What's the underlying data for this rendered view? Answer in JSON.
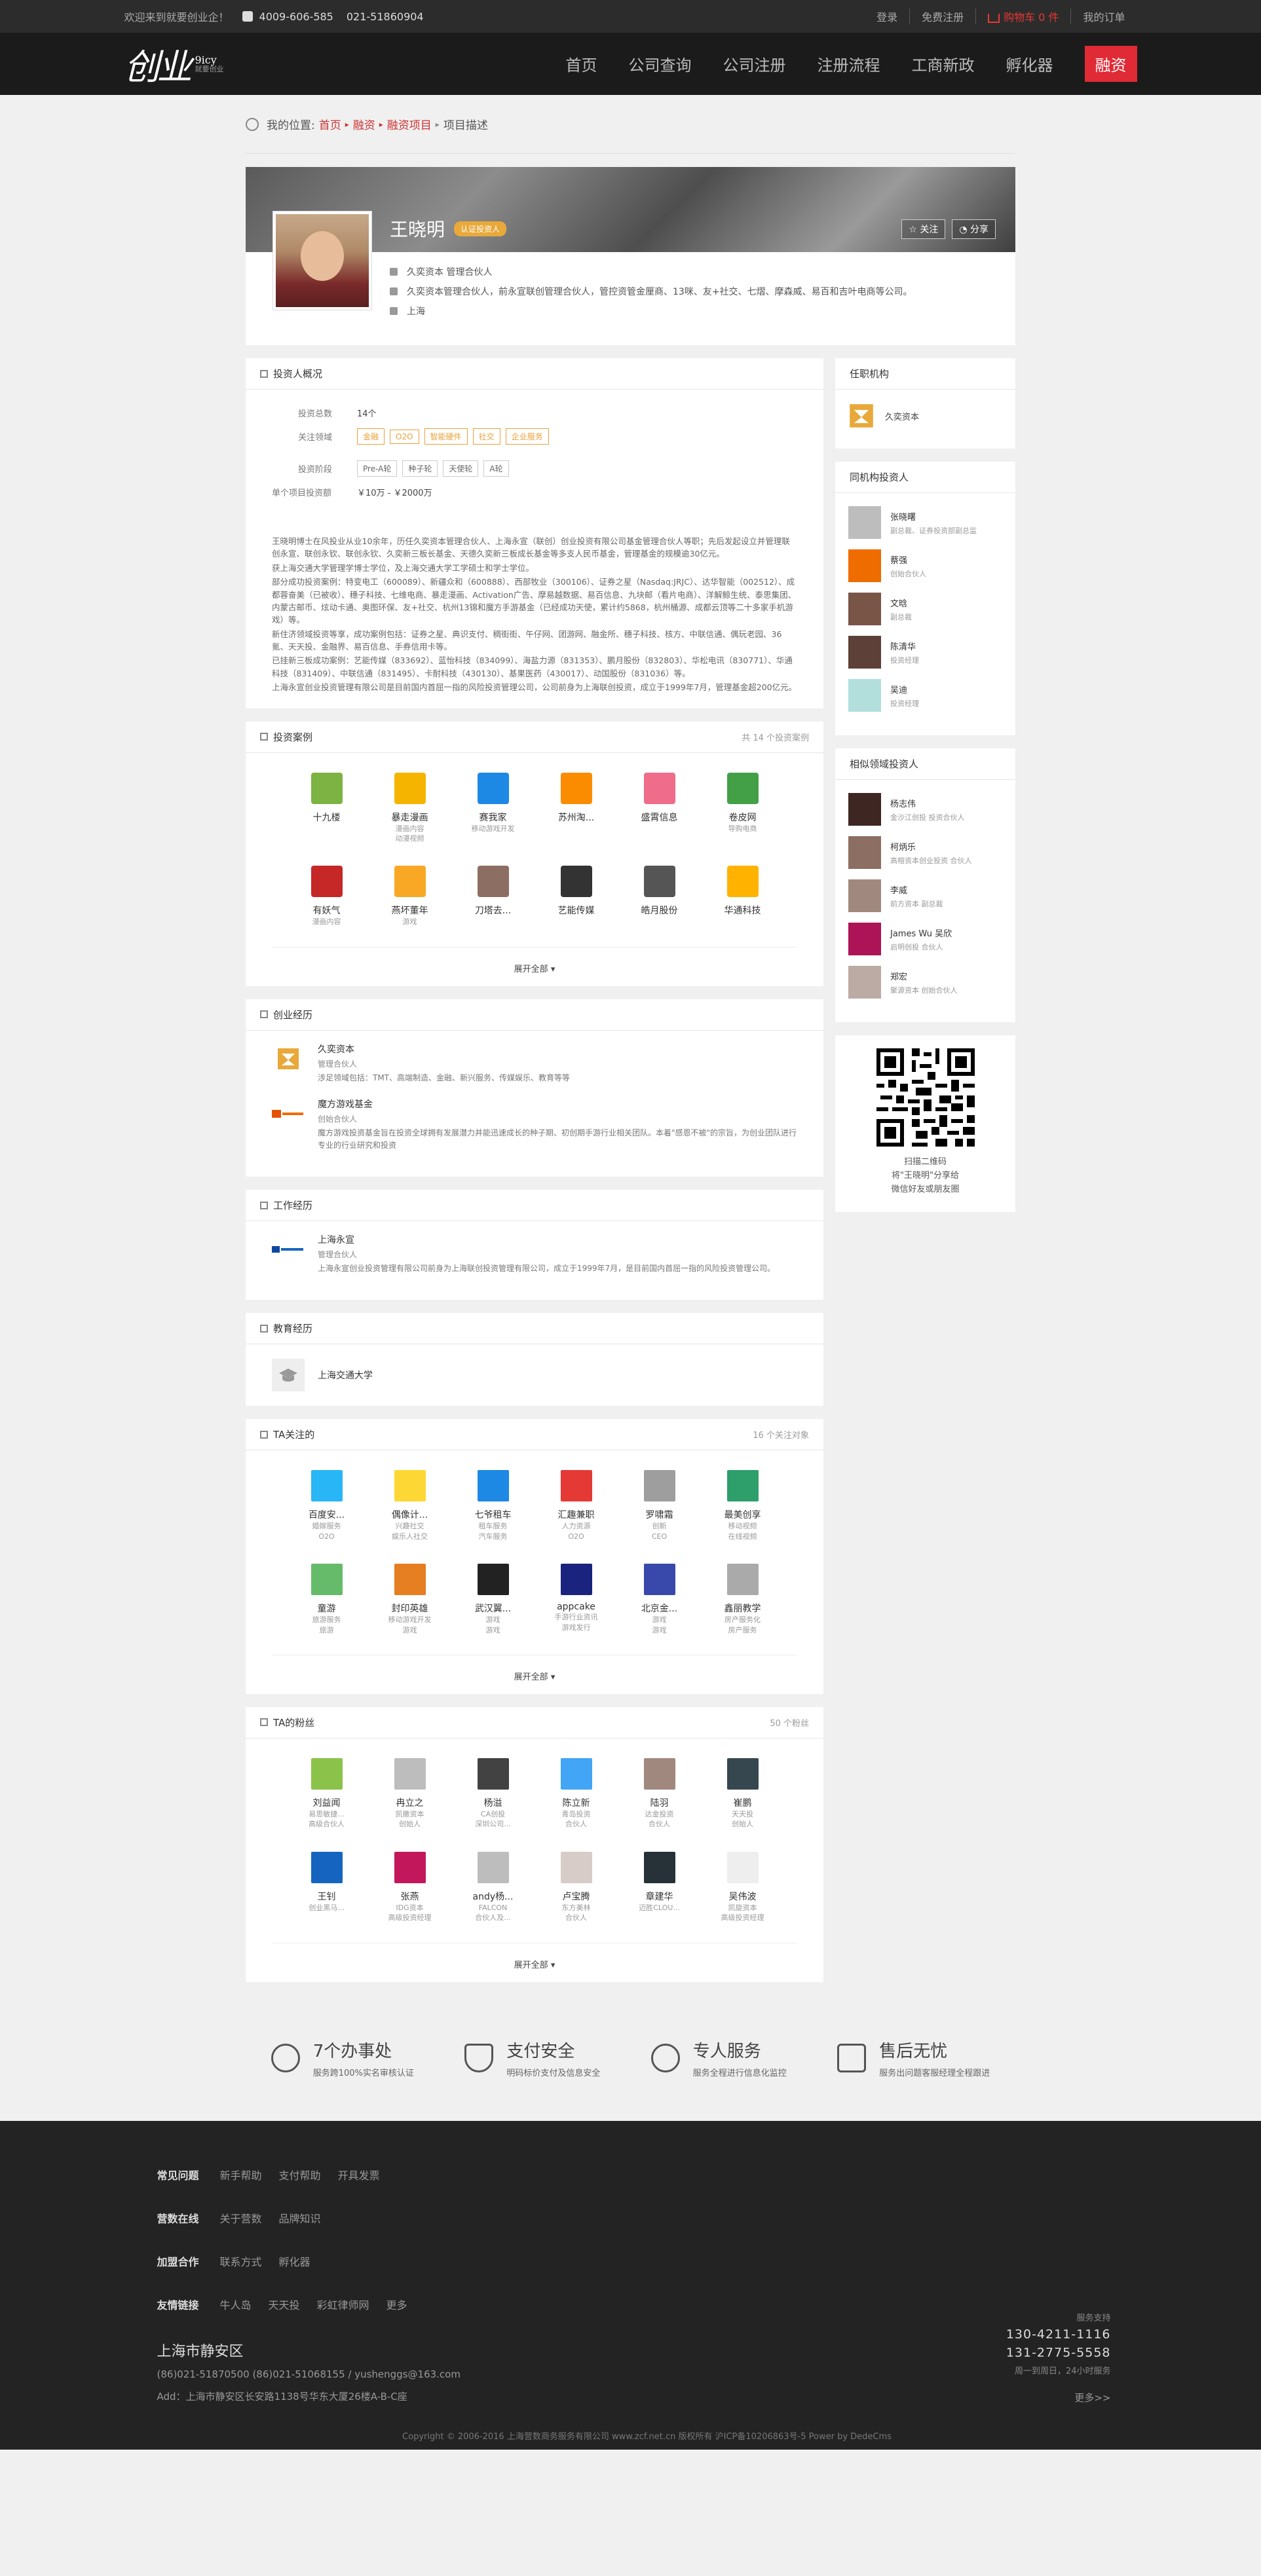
{
  "topbar": {
    "welcome": "欢迎来到就要创业企！",
    "phone1": "4009-606-585",
    "phone2": "021-51860904",
    "login": "登录",
    "register": "免费注册",
    "cart": "购物车 0 件",
    "orders": "我的订单"
  },
  "logo": {
    "text": "创业",
    "en": "9icy",
    "sub": "就要创业"
  },
  "nav": {
    "items": [
      "首页",
      "公司查询",
      "公司注册",
      "注册流程",
      "工商新政",
      "孵化器"
    ],
    "active": "融资"
  },
  "breadcrumb": {
    "label": "我的位置:",
    "items": [
      "首页",
      "融资",
      "融资项目"
    ],
    "current": "项目描述"
  },
  "profile": {
    "name": "王晓明",
    "badge": "认证投资人",
    "follow": "关注",
    "share": "分享",
    "title": "久奕资本 管理合伙人",
    "desc": "久奕资本管理合伙人，前永宣联创管理合伙人，管控资管金厘商、13咪、友+社交、七熠、摩森威、易百和吉叶电商等公司。",
    "location": "上海"
  },
  "overview": {
    "heading": "投资人概况",
    "count_label": "投资总数",
    "count": "14个",
    "fields_label": "关注领域",
    "fields": [
      "金融",
      "O2O",
      "智能硬件",
      "社交",
      "企业服务"
    ],
    "stages_label": "投资阶段",
    "stages": [
      "Pre-A轮",
      "种子轮",
      "天使轮",
      "A轮"
    ],
    "amount_label": "单个项目投资额",
    "amount": "￥10万 - ￥2000万",
    "paragraphs": [
      "王晓明博士在风投业从业10余年，历任久奕资本管理合伙人、上海永宣（联创）创业投资有限公司基金管理合伙人等职；先后发起设立并管理联创永宣、联创永钦、联创永钦、久奕新三板长基金、天德久奕新三板成长基金等多支人民币基金，管理基金的规模逾30亿元。",
      "获上海交通大学管理学博士学位，及上海交通大学工学硕士和学士学位。",
      "部分成功投资案例：特变电工（600089）、新疆众和（600888）、西部牧业（300106）、证券之星（Nasdaq:JRJC）、达华智能（002512）、成都蓉奋美（已被收）、穗子科技、七维电商、暴走漫画、Activation广告、摩易越数据、易百信息、九块邮（看片电商）、洋解鲸生统、泰思集团、内蒙古邮币、炫动卡通、奥图环保、友+社交、杭州13锦和魔方手游基金（已经成功天使，累计约5868，杭州桶源、成都云顶等二十多家手机游戏）等。",
      "新住济领域投资等享，成功案例包括：证券之星、典识支付、稠街街、午仔网、团游网、融金所、穗子科技、核方、中联信通、偶玩老园、36氪、天天投、金融界、易百信息、手券信用卡等。",
      "已挂新三板成功案例：艺能传媒（833692）、蓝怡科技（834099）、海盐力源（831353）、鹏月股份（832803）、华松电讯（830771）、华通科技（831409）、中联信通（831495）、卡耐科技（430130）、基果医药（430017）、动国股份（831036）等。",
      "上海永宣创业投资管理有限公司是目前国内首屈一指的风险投资管理公司，公司前身为上海联创投资，成立于1999年7月，管理基金超200亿元。"
    ]
  },
  "cases": {
    "heading": "投资案例",
    "count": "共 14 个投资案例",
    "more": "展开全部",
    "items": [
      {
        "name": "十九楼",
        "sub": "",
        "color": "#7cb342"
      },
      {
        "name": "暴走漫画",
        "sub": "漫画内容\n动漫视频",
        "color": "#f4b400"
      },
      {
        "name": "赛我家",
        "sub": "移动游戏开发",
        "color": "#1e88e5"
      },
      {
        "name": "苏州淘...",
        "sub": "",
        "color": "#fb8c00"
      },
      {
        "name": "盛霄信息",
        "sub": "",
        "color": "#ef6c8a"
      },
      {
        "name": "卷皮网",
        "sub": "导购电商",
        "color": "#43a047"
      },
      {
        "name": "有妖气",
        "sub": "漫画内容",
        "color": "#c62828"
      },
      {
        "name": "燕坏董年",
        "sub": "游戏",
        "color": "#f9a825"
      },
      {
        "name": "刀塔去...",
        "sub": "",
        "color": "#8d6e63"
      },
      {
        "name": "艺能传媒",
        "sub": "",
        "color": "#333333"
      },
      {
        "name": "皓月股份",
        "sub": "",
        "color": "#555555"
      },
      {
        "name": "华通科技",
        "sub": "",
        "color": "#ffb300"
      }
    ]
  },
  "startup": {
    "heading": "创业经历",
    "items": [
      {
        "name": "久奕资本",
        "role": "管理合伙人",
        "desc": "涉足领域包括：TMT、高端制造、金融、新兴服务、传媒娱乐、教育等等",
        "color": "#e8a93a"
      },
      {
        "name": "魔方游戏基金",
        "role": "创始合伙人",
        "desc": "魔方游戏投资基金旨在投资全球拥有发展潜力并能迅速成长的种子期、初创期手游行业相关团队。本着\"感恩不被\"的宗旨，为创业团队进行专业的行业研究和投资",
        "color": "#e65100"
      }
    ]
  },
  "work": {
    "heading": "工作经历",
    "items": [
      {
        "name": "上海永宣",
        "role": "管理合伙人",
        "desc": "上海永宣创业投资管理有限公司前身为上海联创投资管理有限公司，成立于1999年7月，是目前国内首屈一指的风险投资管理公司。",
        "color": "#0d47a1"
      }
    ]
  },
  "education": {
    "heading": "教育经历",
    "school": "上海交通大学"
  },
  "following": {
    "heading": "TA关注的",
    "count": "16 个关注对象",
    "more": "展开全部",
    "items": [
      {
        "name": "百度安...",
        "sub": "婚嫁服务\nO2O",
        "color": "#29b6f6"
      },
      {
        "name": "偶像计...",
        "sub": "兴趣社交\n娱乐人社交",
        "color": "#fdd835"
      },
      {
        "name": "七爷租车",
        "sub": "租车服务\n汽车服务",
        "color": "#1e88e5"
      },
      {
        "name": "汇趣兼职",
        "sub": "人力资源\nO2O",
        "color": "#e53935"
      },
      {
        "name": "罗啸霜",
        "sub": "创新\nCEO",
        "color": "#9e9e9e"
      },
      {
        "name": "最美创享",
        "sub": "移动视频\n在线视频",
        "color": "#2e9e6a"
      },
      {
        "name": "童游",
        "sub": "旅游服务\n旅游",
        "color": "#66bb6a"
      },
      {
        "name": "封印英雄",
        "sub": "移动游戏开发\n游戏",
        "color": "#e67e22"
      },
      {
        "name": "武汉翼...",
        "sub": "游戏\n游戏",
        "color": "#222222"
      },
      {
        "name": "appcake",
        "sub": "手游行业资讯\n游戏发行",
        "color": "#1a237e"
      },
      {
        "name": "北京金...",
        "sub": "游戏\n游戏",
        "color": "#3949ab"
      },
      {
        "name": "鑫丽教学",
        "sub": "房产服务化\n房产服务",
        "color": "#aaaaaa"
      }
    ]
  },
  "fans": {
    "heading": "TA的粉丝",
    "count": "50 个粉丝",
    "more": "展开全部",
    "items": [
      {
        "name": "刘益闻",
        "sub": "易思敏捷...\n高级合伙人",
        "color": "#8bc34a"
      },
      {
        "name": "冉立之",
        "sub": "凯撒资本\n创始人",
        "color": "#bdbdbd"
      },
      {
        "name": "杨溢",
        "sub": "CA创投\n深圳公司...",
        "color": "#424242"
      },
      {
        "name": "陈立新",
        "sub": "青岛投资\n合伙人",
        "color": "#42a5f5"
      },
      {
        "name": "陆羽",
        "sub": "达金投资\n合伙人",
        "color": "#a1887f"
      },
      {
        "name": "崔鹏",
        "sub": "天天投\n创始人",
        "color": "#37474f"
      },
      {
        "name": "王钊",
        "sub": "创业黑马...",
        "color": "#1565c0"
      },
      {
        "name": "张燕",
        "sub": "IDG资本\n高级投资经理",
        "color": "#c2185b"
      },
      {
        "name": "andy杨...",
        "sub": "FALCON\n合伙人及...",
        "color": "#bdbdbd"
      },
      {
        "name": "卢宝腾",
        "sub": "东方美林\n合伙人",
        "color": "#d7ccc8"
      },
      {
        "name": "章建华",
        "sub": "迈胜CLOU...",
        "color": "#263238"
      },
      {
        "name": "吴伟波",
        "sub": "凯旋资本\n高级投资经理",
        "color": "#eeeeee"
      }
    ]
  },
  "orgs": {
    "heading": "任职机构",
    "items": [
      {
        "name": "久奕资本",
        "color": "#e8a93a"
      }
    ]
  },
  "peers": {
    "heading": "同机构投资人",
    "items": [
      {
        "name": "张晓曙",
        "role": "副总裁、证券投资部副总监",
        "color": "#bdbdbd"
      },
      {
        "name": "蔡强",
        "role": "创始合伙人",
        "color": "#ef6c00"
      },
      {
        "name": "文晗",
        "role": "副总裁",
        "color": "#795548"
      },
      {
        "name": "陈清华",
        "role": "投资经理",
        "color": "#5d4037"
      },
      {
        "name": "吴迪",
        "role": "投资经理",
        "color": "#b2dfdb"
      }
    ]
  },
  "similar": {
    "heading": "相似领域投资人",
    "items": [
      {
        "name": "杨志伟",
        "role": "金沙江创投 投资合伙人",
        "color": "#3e2723"
      },
      {
        "name": "柯炳乐",
        "role": "高榕资本创业投资 合伙人",
        "color": "#8d6e63"
      },
      {
        "name": "李威",
        "role": "前方资本 副总裁",
        "color": "#a1887f"
      },
      {
        "name": "James Wu 吴欣",
        "role": "启明创投 合伙人",
        "color": "#ad1457"
      },
      {
        "name": "郑宏",
        "role": "聚源资本 创始合伙人",
        "color": "#bcaaa4"
      }
    ]
  },
  "qr": {
    "line1": "扫描二维码",
    "line2": "将\"王晓明\"分享给",
    "line3": "微信好友或朋友圈"
  },
  "features": [
    {
      "title": "7个办事处",
      "sub": "服务跨100%实名审核认证"
    },
    {
      "title": "支付安全",
      "sub": "明码标价支付及信息安全"
    },
    {
      "title": "专人服务",
      "sub": "服务全程进行信息化监控"
    },
    {
      "title": "售后无忧",
      "sub": "服务出问题客服经理全程跟进"
    }
  ],
  "footer": {
    "rows": [
      {
        "head": "常见问题",
        "links": [
          "新手帮助",
          "支付帮助",
          "开具发票"
        ]
      },
      {
        "head": "营数在线",
        "links": [
          "关于营数",
          "品牌知识"
        ]
      },
      {
        "head": "加盟合作",
        "links": [
          "联系方式",
          "孵化器"
        ]
      },
      {
        "head": "友情链接",
        "links": [
          "牛人岛",
          "天天投",
          "彩虹律师网",
          "更多"
        ]
      }
    ],
    "address_title": "上海市静安区",
    "contacts": "(86)021-51870500     (86)021-51068155 / yushenggs@163.com",
    "address": "Add：上海市静安区长安路1138号华东大厦26楼A-B-C座",
    "support_label": "服务支持",
    "phone1": "130-4211-1116",
    "phone2": "131-2775-5558",
    "hours": "周一到周日，24小时服务",
    "more": "更多>>",
    "copyright": "Copyright © 2006-2016 上海营数商务服务有限公司 www.zcf.net.cn 版权所有  沪ICP备10206863号-5 Power by DedeCms"
  }
}
